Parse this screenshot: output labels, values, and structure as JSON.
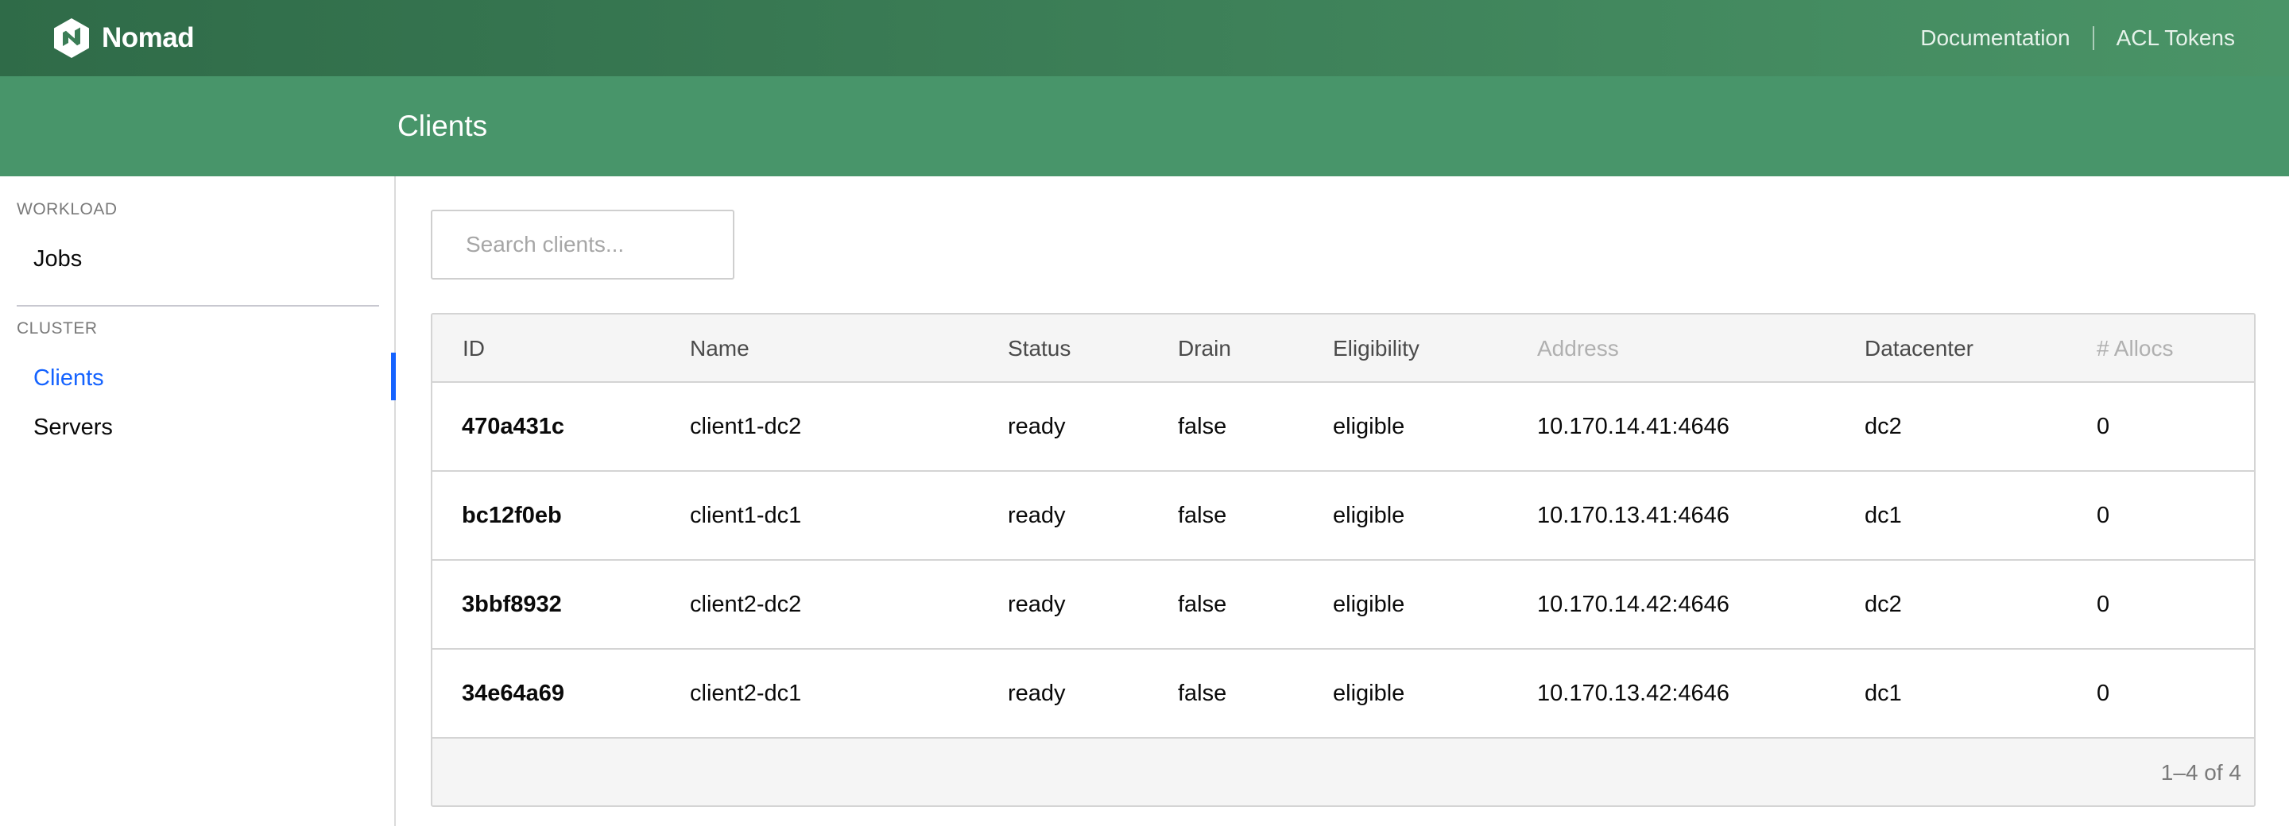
{
  "navbar": {
    "brand": "Nomad",
    "links": {
      "documentation": "Documentation",
      "acl_tokens": "ACL Tokens"
    }
  },
  "subnav": {
    "title": "Clients"
  },
  "sidebar": {
    "sections": [
      {
        "label": "WORKLOAD",
        "items": [
          {
            "label": "Jobs",
            "active": false
          }
        ]
      },
      {
        "label": "CLUSTER",
        "items": [
          {
            "label": "Clients",
            "active": true
          },
          {
            "label": "Servers",
            "active": false
          }
        ]
      }
    ]
  },
  "search": {
    "placeholder": "Search clients...",
    "value": ""
  },
  "table": {
    "columns": [
      "ID",
      "Name",
      "Status",
      "Drain",
      "Eligibility",
      "Address",
      "Datacenter",
      "# Allocs"
    ],
    "rows": [
      {
        "id": "470a431c",
        "name": "client1-dc2",
        "status": "ready",
        "drain": "false",
        "eligibility": "eligible",
        "address": "10.170.14.41:4646",
        "datacenter": "dc2",
        "allocs": "0"
      },
      {
        "id": "bc12f0eb",
        "name": "client1-dc1",
        "status": "ready",
        "drain": "false",
        "eligibility": "eligible",
        "address": "10.170.13.41:4646",
        "datacenter": "dc1",
        "allocs": "0"
      },
      {
        "id": "3bbf8932",
        "name": "client2-dc2",
        "status": "ready",
        "drain": "false",
        "eligibility": "eligible",
        "address": "10.170.14.42:4646",
        "datacenter": "dc2",
        "allocs": "0"
      },
      {
        "id": "34e64a69",
        "name": "client2-dc1",
        "status": "ready",
        "drain": "false",
        "eligibility": "eligible",
        "address": "10.170.13.42:4646",
        "datacenter": "dc1",
        "allocs": "0"
      }
    ],
    "pagination": "1–4 of 4"
  },
  "colors": {
    "navbar": "#3b7d56",
    "subnav": "#48956a",
    "accent": "#1563ff"
  }
}
